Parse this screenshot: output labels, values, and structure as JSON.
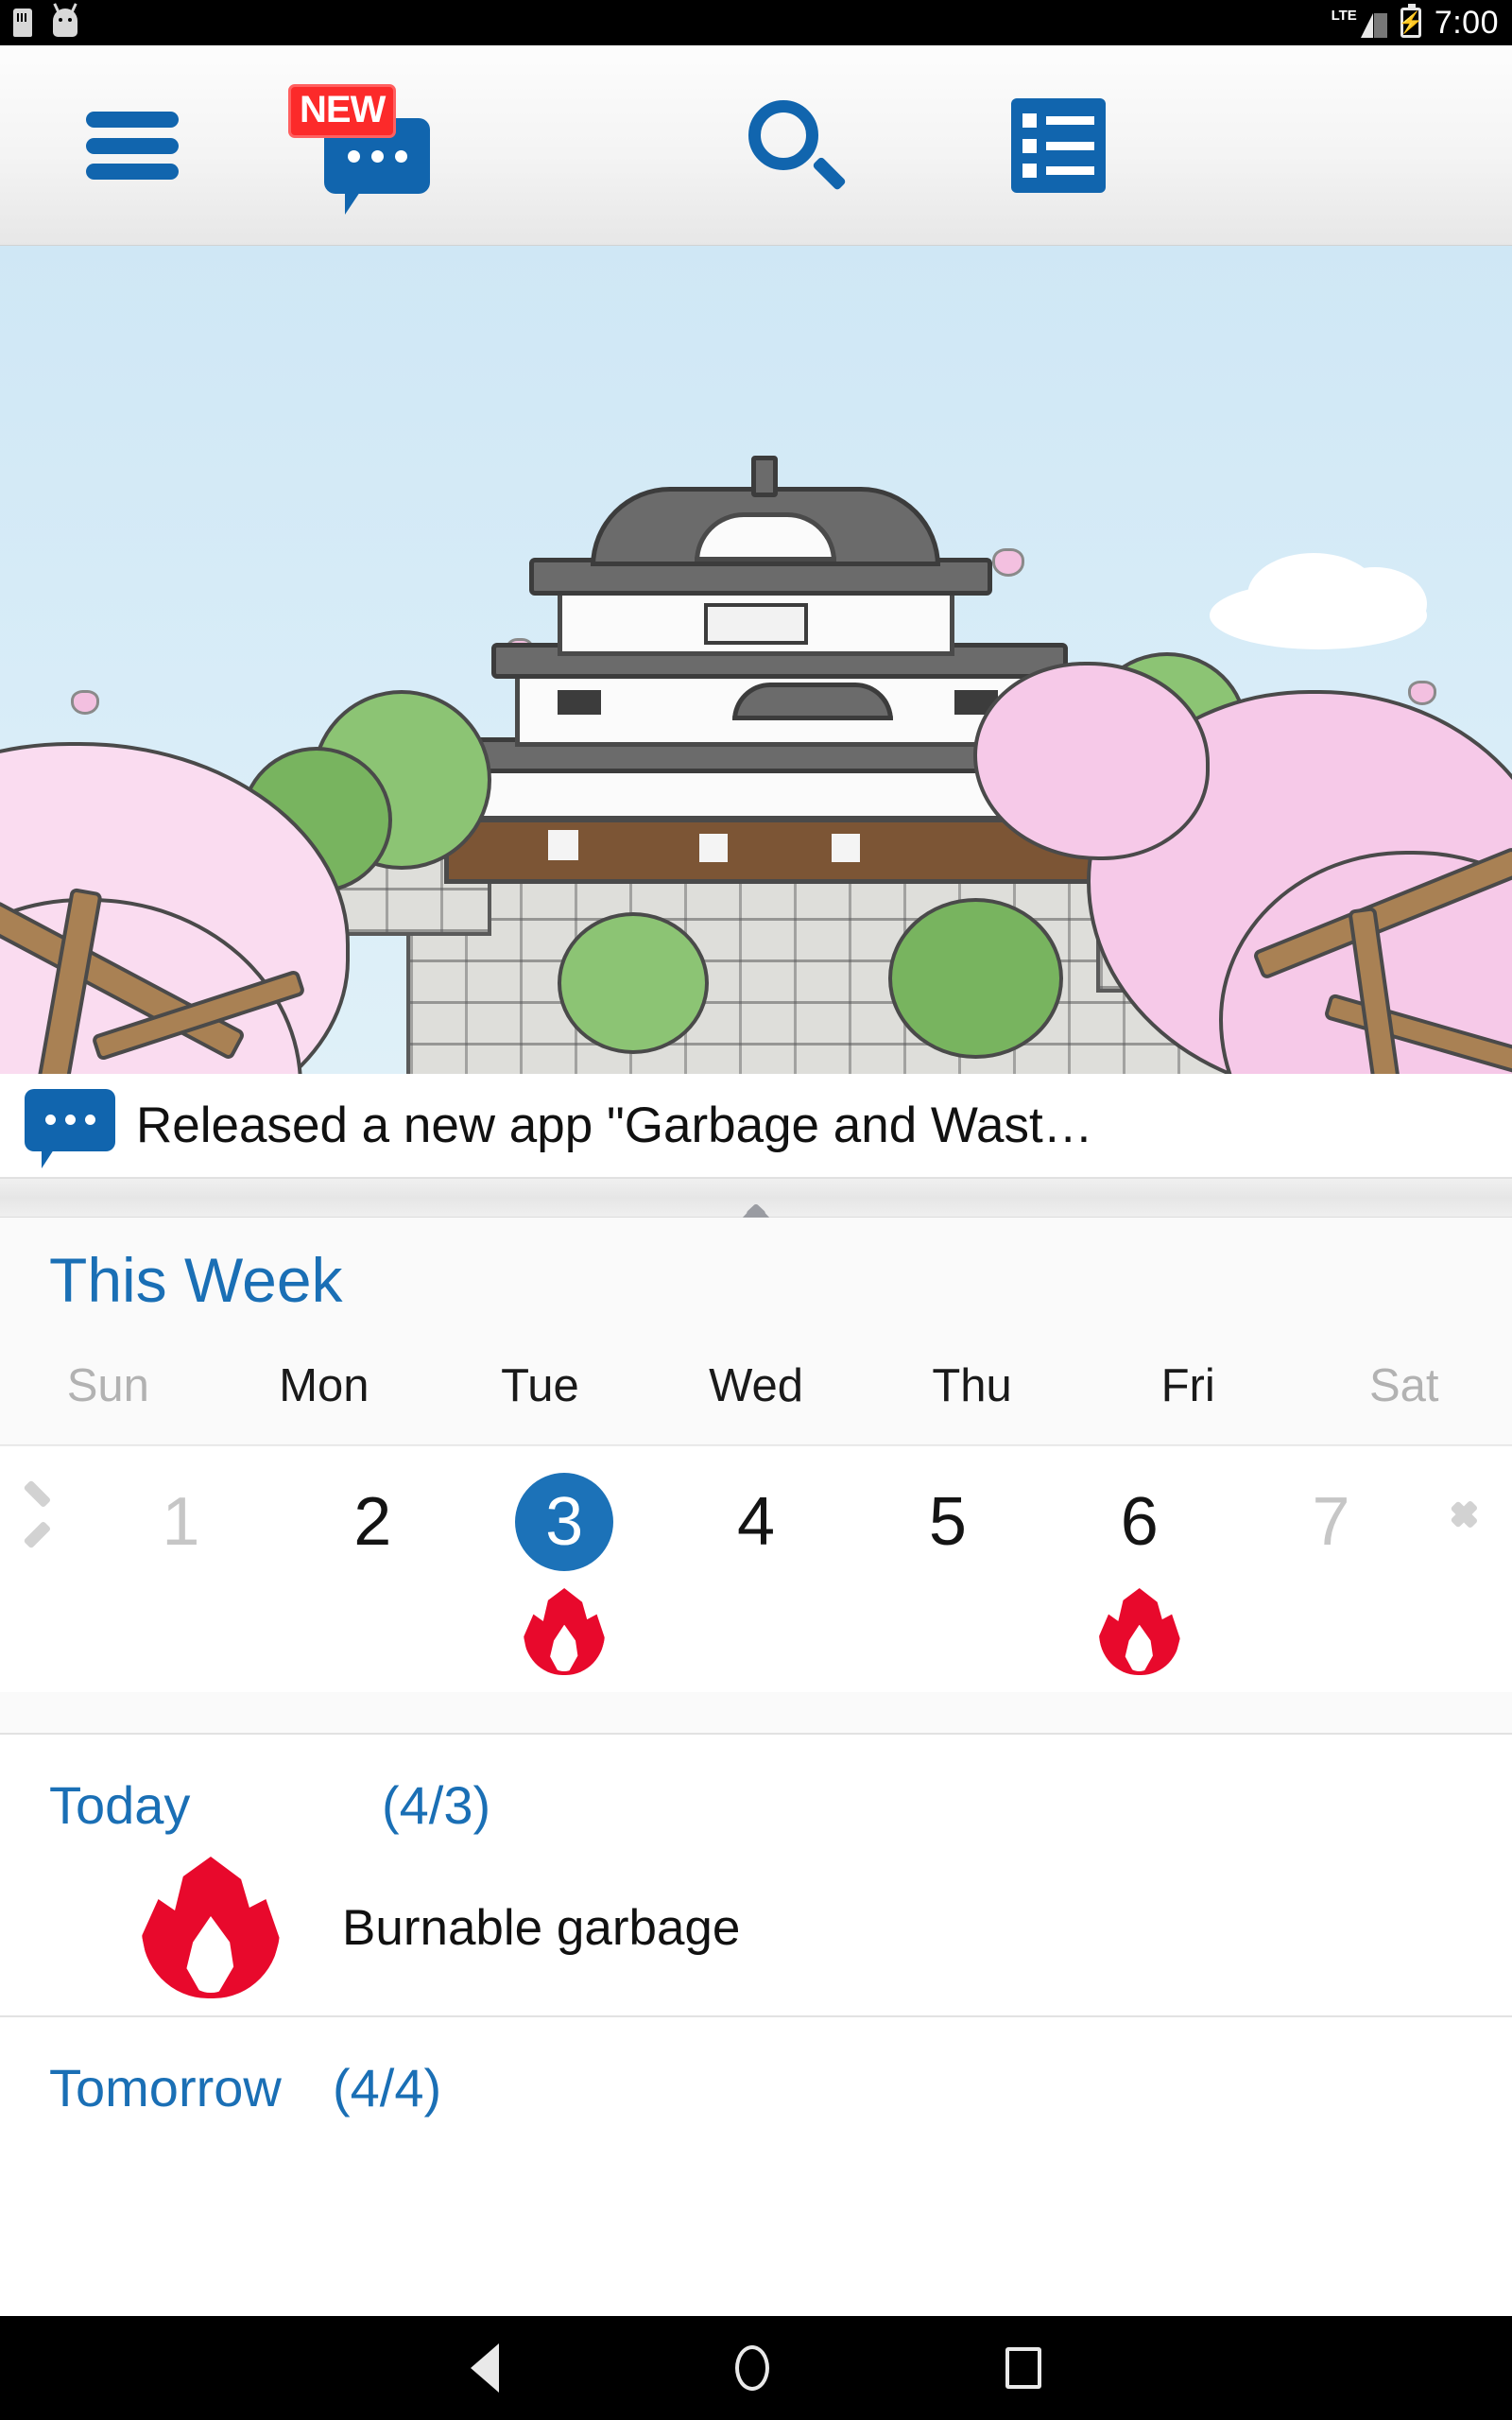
{
  "statusbar": {
    "time": "7:00",
    "network_label": "LTE",
    "icons": [
      "sim-card-icon",
      "android-notification-icon",
      "signal-icon",
      "battery-charging-icon"
    ]
  },
  "toolbar": {
    "menu_label": "menu-icon",
    "message_label": "message-icon",
    "new_badge": "NEW",
    "search_label": "search-icon",
    "list_label": "list-icon"
  },
  "hero": {
    "alt": "Japanese castle with cherry blossoms illustration"
  },
  "news": {
    "text": "Released a new app \"Garbage and Wast…"
  },
  "week": {
    "title": "This Week",
    "day_names": [
      "Sun",
      "Mon",
      "Tue",
      "Wed",
      "Thu",
      "Fri",
      "Sat"
    ],
    "days": [
      {
        "num": "1",
        "dim": true,
        "today": false,
        "flame": false
      },
      {
        "num": "2",
        "dim": false,
        "today": false,
        "flame": false
      },
      {
        "num": "3",
        "dim": false,
        "today": true,
        "flame": true
      },
      {
        "num": "4",
        "dim": false,
        "today": false,
        "flame": false
      },
      {
        "num": "5",
        "dim": false,
        "today": false,
        "flame": false
      },
      {
        "num": "6",
        "dim": false,
        "today": false,
        "flame": true
      },
      {
        "num": "7",
        "dim": true,
        "today": false,
        "flame": false
      }
    ],
    "prev_arrow": "chevron-left-icon",
    "next_arrow": "chevron-right-icon",
    "collapse_handle": "chevron-up-icon"
  },
  "schedule": {
    "today": {
      "label": "Today",
      "date": "(4/3)",
      "items": [
        {
          "icon": "flame-icon",
          "name": "Burnable garbage"
        }
      ]
    },
    "tomorrow": {
      "label": "Tomorrow",
      "date": "(4/4)",
      "items": []
    }
  },
  "navbar": {
    "back": "back-triangle-icon",
    "home": "home-circle-icon",
    "recents": "recents-square-icon"
  },
  "colors": {
    "accent_blue": "#1165ae",
    "title_blue": "#1a6fb5",
    "today_blue": "#1c72b8",
    "flame_red": "#e8092c",
    "badge_red": "#fc2a2a"
  }
}
